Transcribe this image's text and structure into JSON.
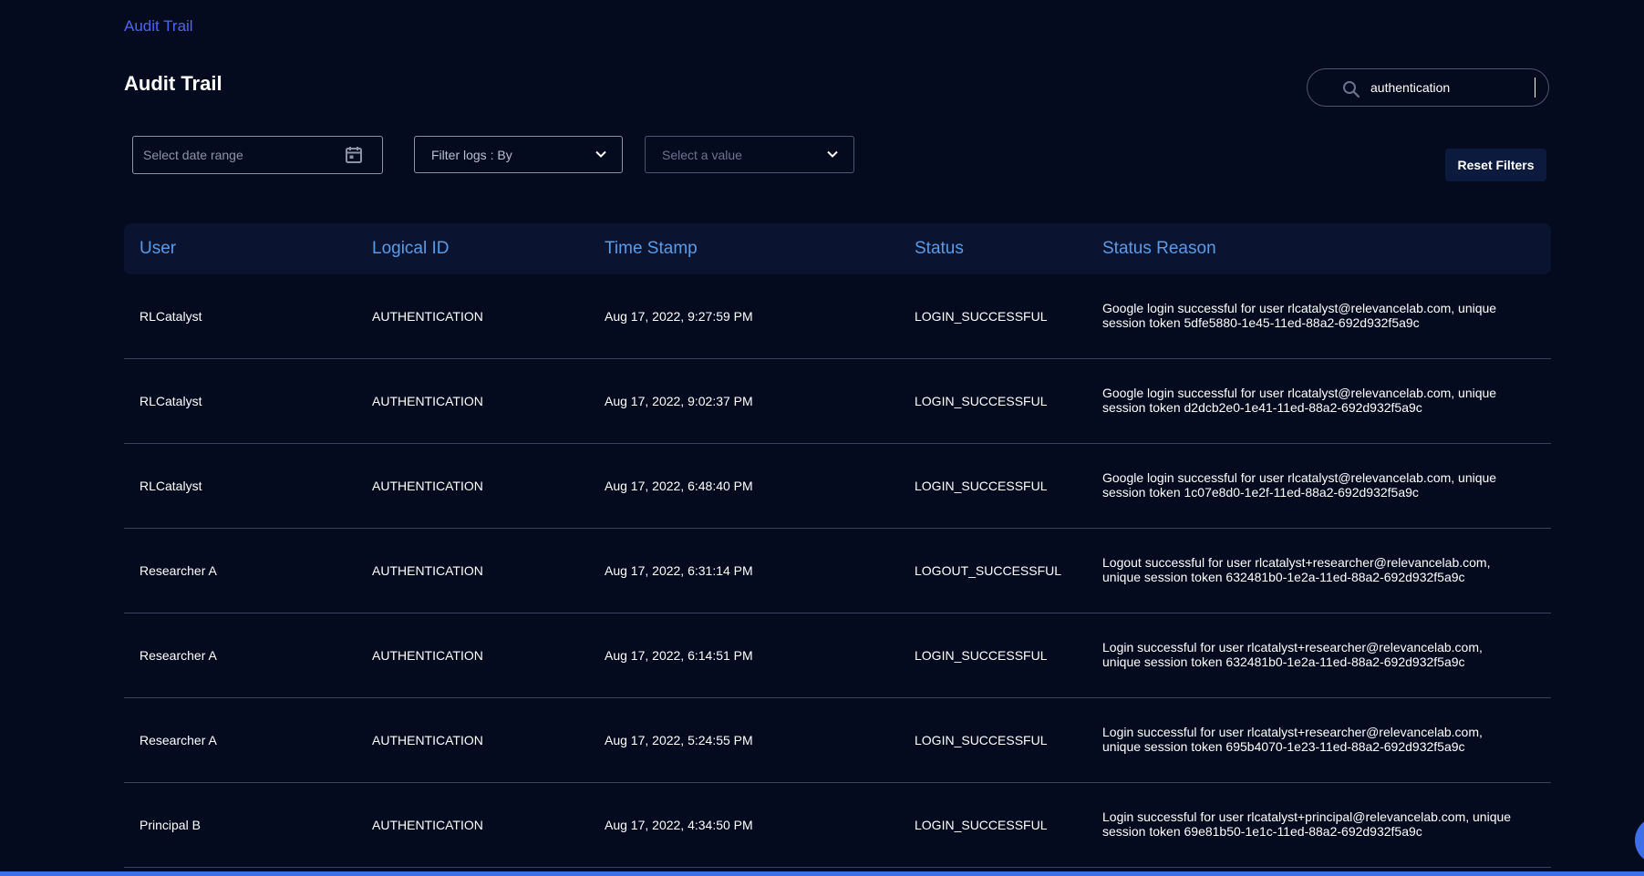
{
  "breadcrumb": "Audit Trail",
  "page_title": "Audit Trail",
  "search": {
    "value": "authentication"
  },
  "filters": {
    "date_range_placeholder": "Select date range",
    "filter_by_label": "Filter logs : By",
    "value_placeholder": "Select a value",
    "reset_label": "Reset Filters"
  },
  "table": {
    "headers": [
      "User",
      "Logical ID",
      "Time Stamp",
      "Status",
      "Status Reason"
    ],
    "rows": [
      {
        "user": "RLCatalyst",
        "logical_id": "AUTHENTICATION",
        "timestamp": "Aug 17, 2022, 9:27:59 PM",
        "status": "LOGIN_SUCCESSFUL",
        "reason": "Google login successful for user rlcatalyst@relevancelab.com, unique session token 5dfe5880-1e45-11ed-88a2-692d932f5a9c"
      },
      {
        "user": "RLCatalyst",
        "logical_id": "AUTHENTICATION",
        "timestamp": "Aug 17, 2022, 9:02:37 PM",
        "status": "LOGIN_SUCCESSFUL",
        "reason": "Google login successful for user rlcatalyst@relevancelab.com, unique session token d2dcb2e0-1e41-11ed-88a2-692d932f5a9c"
      },
      {
        "user": "RLCatalyst",
        "logical_id": "AUTHENTICATION",
        "timestamp": "Aug 17, 2022, 6:48:40 PM",
        "status": "LOGIN_SUCCESSFUL",
        "reason": "Google login successful for user rlcatalyst@relevancelab.com, unique session token 1c07e8d0-1e2f-11ed-88a2-692d932f5a9c"
      },
      {
        "user": "Researcher A",
        "logical_id": "AUTHENTICATION",
        "timestamp": "Aug 17, 2022, 6:31:14 PM",
        "status": "LOGOUT_SUCCESSFUL",
        "reason": "Logout successful for user rlcatalyst+researcher@relevancelab.com, unique session token 632481b0-1e2a-11ed-88a2-692d932f5a9c"
      },
      {
        "user": "Researcher A",
        "logical_id": "AUTHENTICATION",
        "timestamp": "Aug 17, 2022, 6:14:51 PM",
        "status": "LOGIN_SUCCESSFUL",
        "reason": "Login successful for user rlcatalyst+researcher@relevancelab.com, unique session token 632481b0-1e2a-11ed-88a2-692d932f5a9c"
      },
      {
        "user": "Researcher A",
        "logical_id": "AUTHENTICATION",
        "timestamp": "Aug 17, 2022, 5:24:55 PM",
        "status": "LOGIN_SUCCESSFUL",
        "reason": "Login successful for user rlcatalyst+researcher@relevancelab.com, unique session token 695b4070-1e23-11ed-88a2-692d932f5a9c"
      },
      {
        "user": "Principal B",
        "logical_id": "AUTHENTICATION",
        "timestamp": "Aug 17, 2022, 4:34:50 PM",
        "status": "LOGIN_SUCCESSFUL",
        "reason": "Login successful for user rlcatalyst+principal@relevancelab.com, unique session token 69e81b50-1e1c-11ed-88a2-692d932f5a9c"
      }
    ]
  },
  "colors": {
    "background": "#050b1f",
    "header_text": "#5b9be6",
    "breadcrumb": "#4f63f0",
    "accent": "#3f6fe8"
  },
  "icons": {
    "search": "search-icon",
    "calendar": "calendar-icon",
    "chevron": "chevron-down-icon"
  }
}
